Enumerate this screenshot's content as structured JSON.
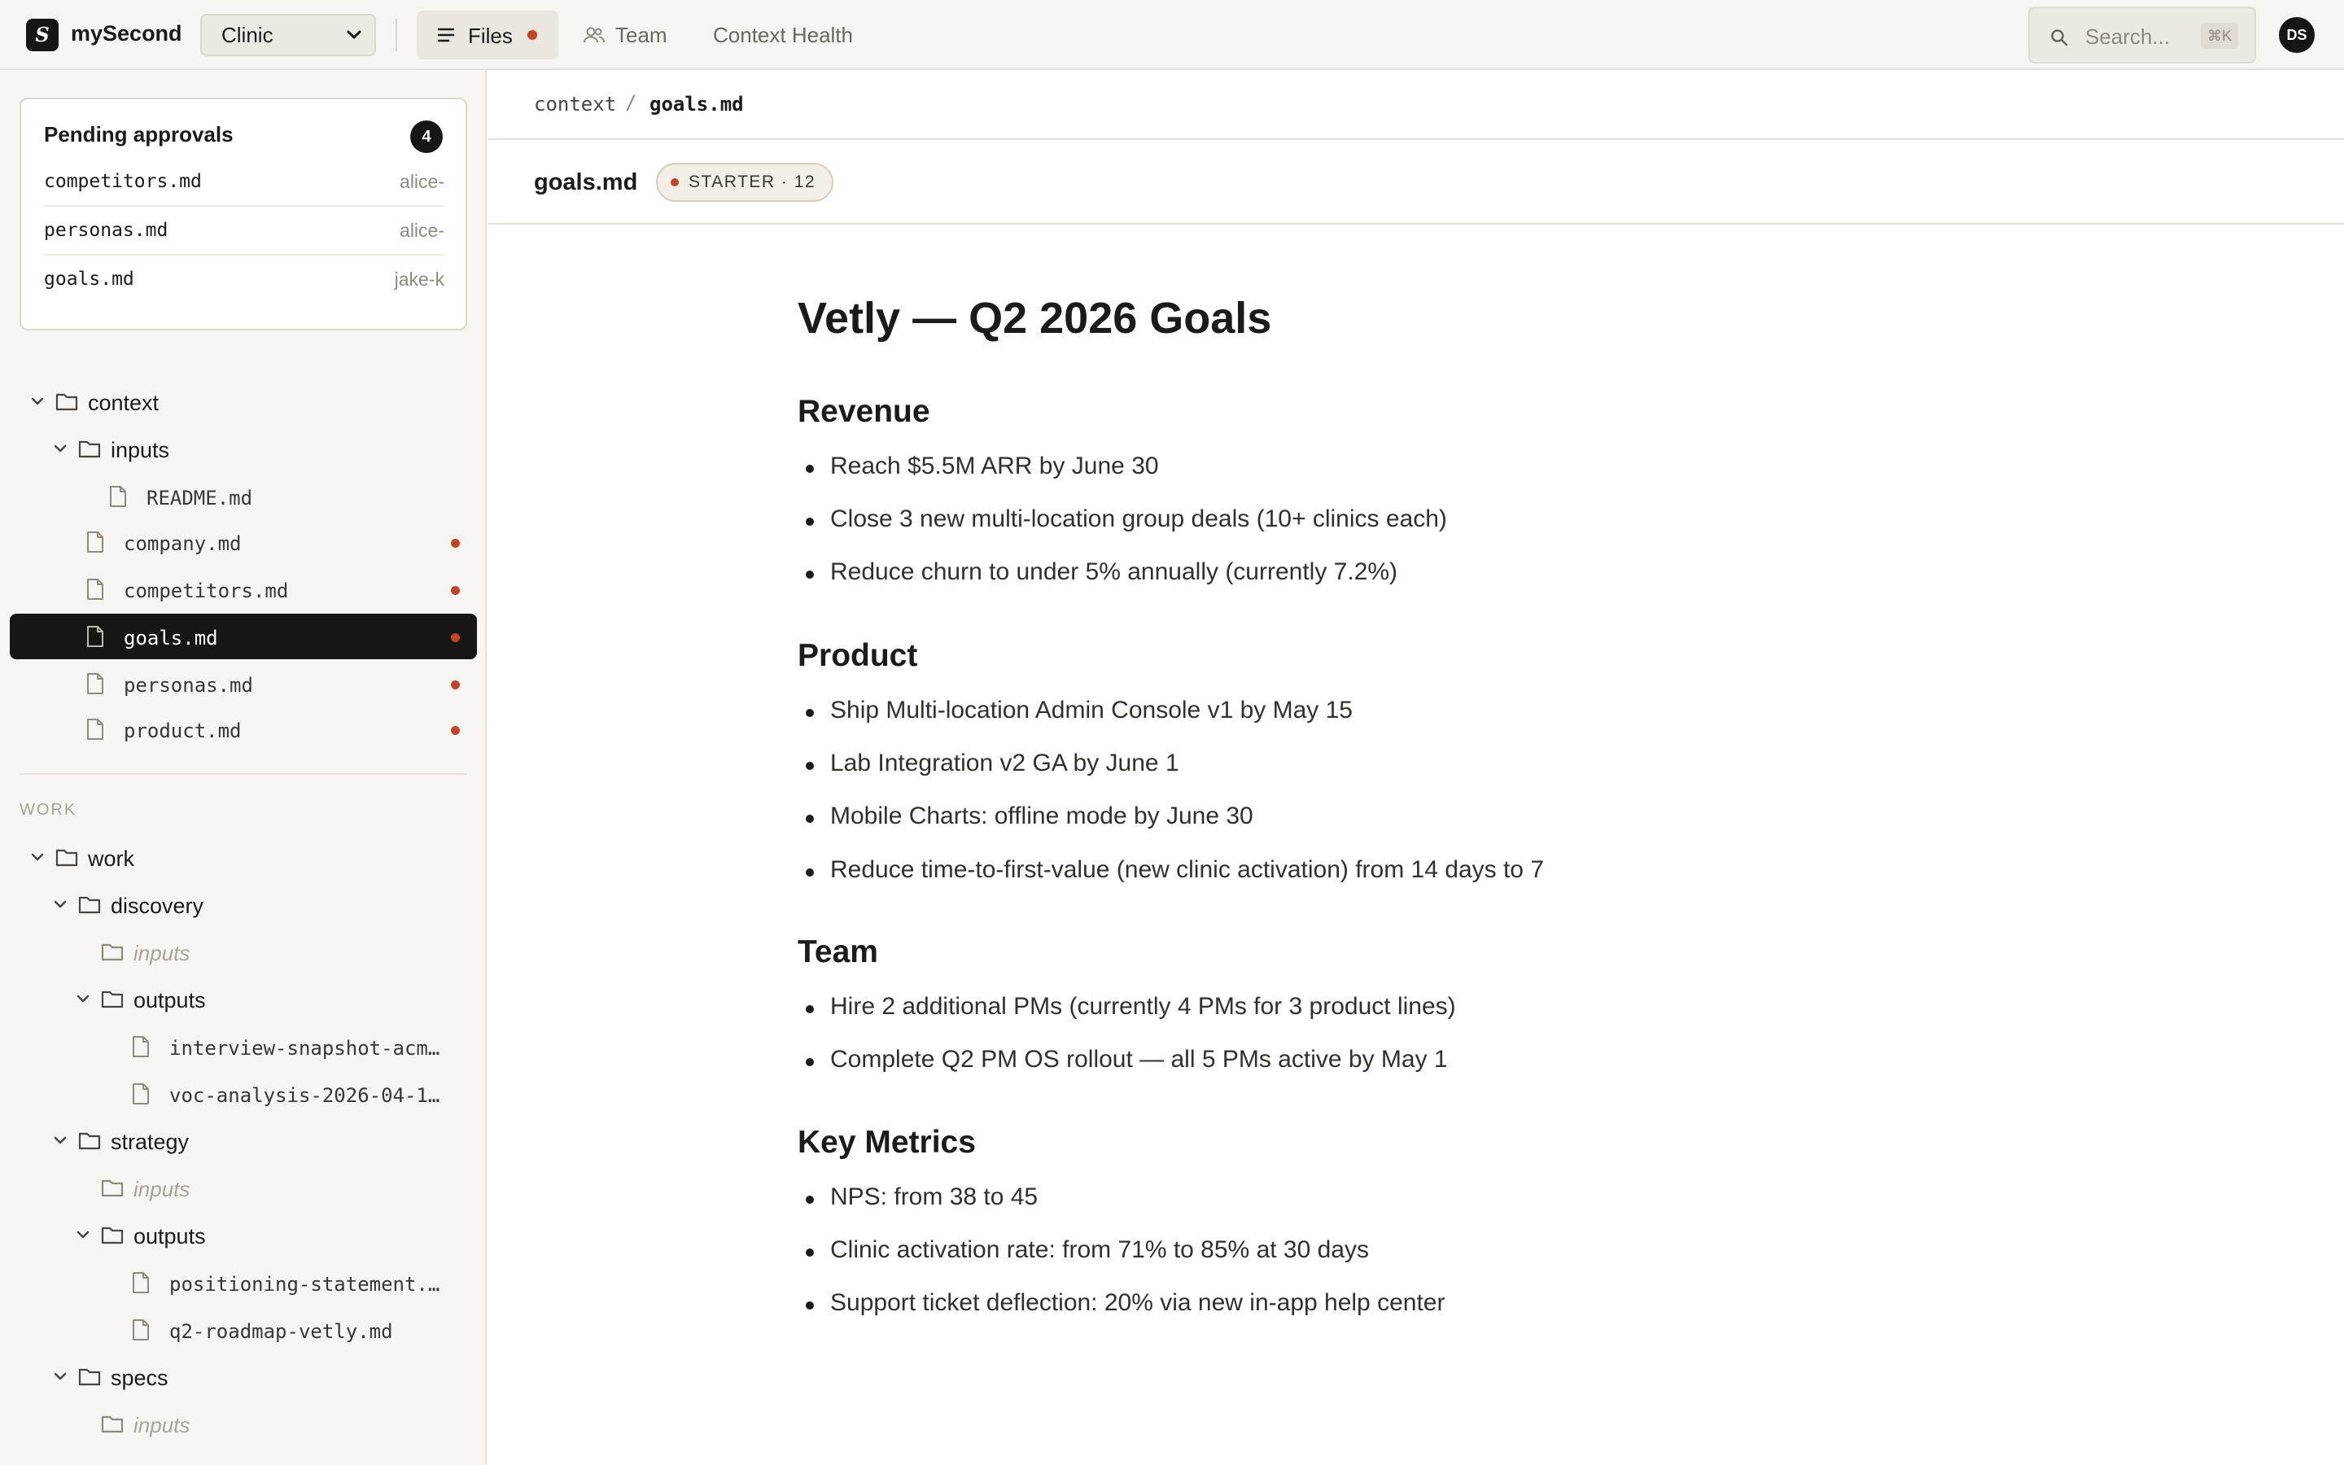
{
  "app": {
    "logo_letter": "S",
    "name": "mySecond",
    "workspace": "Clinic"
  },
  "nav": {
    "files": "Files",
    "team": "Team",
    "context_health": "Context Health"
  },
  "search": {
    "placeholder": "Search...",
    "shortcut": "⌘K"
  },
  "user": {
    "initials": "DS"
  },
  "colors": {
    "accent_dot": "#c0442a",
    "dark": "#171615",
    "sidebar_bg": "#f7f5f1"
  },
  "pending": {
    "title": "Pending approvals",
    "count": "4",
    "items": [
      {
        "file": "competitors.md",
        "user": "alice-"
      },
      {
        "file": "personas.md",
        "user": "alice-"
      },
      {
        "file": "goals.md",
        "user": "jake-k"
      }
    ]
  },
  "tree_context": {
    "root": "context",
    "inputs": "inputs",
    "readme": "README.md",
    "files": [
      "company.md",
      "competitors.md",
      "goals.md",
      "personas.md",
      "product.md"
    ]
  },
  "work_section": {
    "label": "WORK",
    "root": "work",
    "discovery": "discovery",
    "discovery_inputs": "inputs",
    "discovery_outputs": "outputs",
    "discovery_files": [
      "interview-snapshot-acm…",
      "voc-analysis-2026-04-1…"
    ],
    "strategy": "strategy",
    "strategy_inputs": "inputs",
    "strategy_outputs": "outputs",
    "strategy_files": [
      "positioning-statement.…",
      "q2-roadmap-vetly.md"
    ],
    "specs": "specs",
    "specs_inputs": "inputs"
  },
  "breadcrumb": {
    "parent": "context",
    "separator": "/",
    "current": "goals.md"
  },
  "doc_header": {
    "filename": "goals.md",
    "badge": "STARTER · 12"
  },
  "document": {
    "title": "Vetly — Q2 2026 Goals",
    "sections": [
      {
        "heading": "Revenue",
        "items": [
          "Reach $5.5M ARR by June 30",
          "Close 3 new multi-location group deals (10+ clinics each)",
          "Reduce churn to under 5% annually (currently 7.2%)"
        ]
      },
      {
        "heading": "Product",
        "items": [
          "Ship Multi-location Admin Console v1 by May 15",
          "Lab Integration v2 GA by June 1",
          "Mobile Charts: offline mode by June 30",
          "Reduce time-to-first-value (new clinic activation) from 14 days to 7"
        ]
      },
      {
        "heading": "Team",
        "items": [
          "Hire 2 additional PMs (currently 4 PMs for 3 product lines)",
          "Complete Q2 PM OS rollout — all 5 PMs active by May 1"
        ]
      },
      {
        "heading": "Key Metrics",
        "items": [
          "NPS: from 38 to 45",
          "Clinic activation rate: from 71% to 85% at 30 days",
          "Support ticket deflection: 20% via new in-app help center"
        ]
      }
    ]
  }
}
